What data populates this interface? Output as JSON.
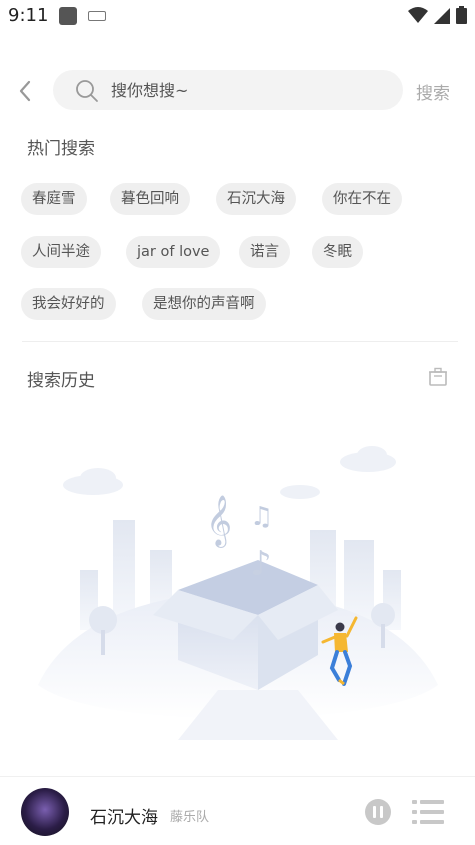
{
  "status": {
    "time": "9:11"
  },
  "search": {
    "placeholder": "搜你想搜~",
    "button_label": "搜索"
  },
  "hot": {
    "title": "热门搜索",
    "tags": [
      "春庭雪",
      "暮色回响",
      "石沉大海",
      "你在不在",
      "人间半途",
      "jar of love",
      "诺言",
      "冬眠",
      "我会好好的",
      "是想你的声音啊"
    ]
  },
  "history": {
    "title": "搜索历史"
  },
  "player": {
    "song": "石沉大海",
    "artist": "藤乐队"
  },
  "colors": {
    "chip_bg": "#efefef",
    "search_bg": "#f3f3f3",
    "accent_figure": "#f5b731"
  }
}
